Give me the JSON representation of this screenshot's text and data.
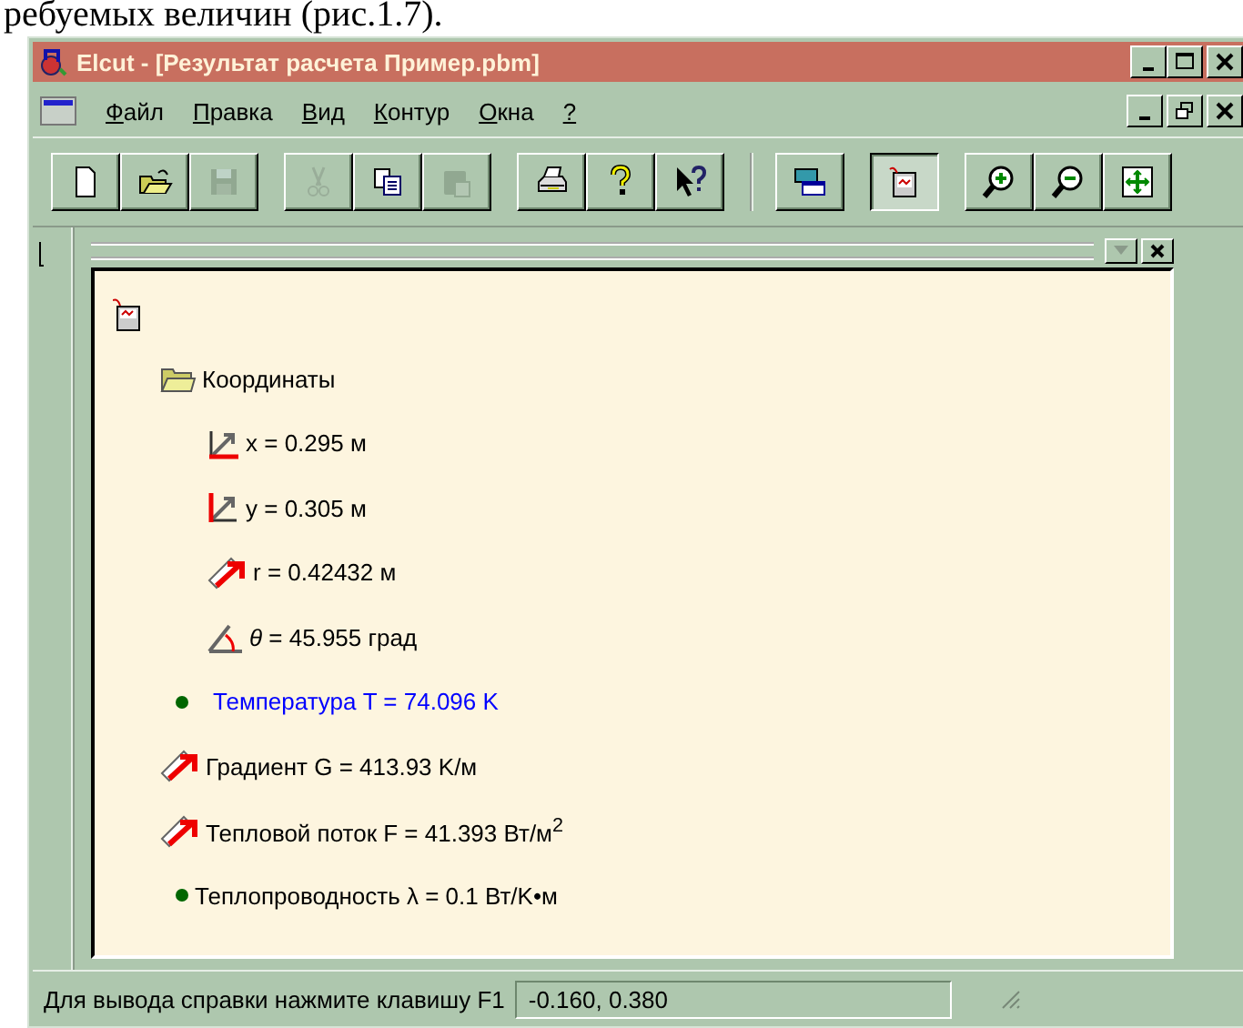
{
  "document_text": "ребуемых величин (рис.1.7).",
  "window": {
    "title": "Elcut - [Результат расчета Пример.pbm]"
  },
  "menu": [
    {
      "label": "Файл"
    },
    {
      "label": "Правка"
    },
    {
      "label": "Вид"
    },
    {
      "label": "Контур"
    },
    {
      "label": "Окна"
    },
    {
      "label": "?"
    }
  ],
  "toolbar": [
    [
      {
        "kind": "new",
        "disabled": false,
        "pressed": false
      },
      {
        "kind": "open",
        "disabled": false,
        "pressed": false
      },
      {
        "kind": "save",
        "disabled": true,
        "pressed": false
      }
    ],
    [
      {
        "kind": "cut",
        "disabled": true,
        "pressed": false
      },
      {
        "kind": "copy",
        "disabled": false,
        "pressed": false
      },
      {
        "kind": "paste",
        "disabled": true,
        "pressed": false
      }
    ],
    [
      {
        "kind": "print",
        "disabled": false,
        "pressed": false
      },
      {
        "kind": "help",
        "disabled": false,
        "pressed": false
      },
      {
        "kind": "context-help",
        "disabled": false,
        "pressed": false
      }
    ],
    [
      {
        "kind": "windows",
        "disabled": false,
        "pressed": false
      }
    ],
    [
      {
        "kind": "results",
        "disabled": false,
        "pressed": true
      }
    ],
    [
      {
        "kind": "zoom-in",
        "disabled": false,
        "pressed": false
      },
      {
        "kind": "zoom-out",
        "disabled": false,
        "pressed": false
      },
      {
        "kind": "fit",
        "disabled": false,
        "pressed": false
      }
    ]
  ],
  "tree": [
    {
      "kind": "results",
      "children": [
        {
          "kind": "folder",
          "label": "Координаты",
          "highlighted": false,
          "children": [
            {
              "kind": "coord-x",
              "label": "x = 0.295 м",
              "highlighted": false
            },
            {
              "kind": "coord-y",
              "label": "y = 0.305 м",
              "highlighted": false
            },
            {
              "kind": "vector",
              "label": "r = 0.42432 м",
              "highlighted": false
            },
            {
              "kind": "angle",
              "label": "*θ* = 45.955 град",
              "highlighted": false
            }
          ]
        },
        {
          "kind": "scalar",
          "label": "Температура T = 74.096 K",
          "highlighted": true
        },
        {
          "kind": "vector",
          "label": "Градиент G = 413.93 K/м",
          "highlighted": false
        },
        {
          "kind": "vector",
          "label": "Тепловой поток F = 41.393 Вт/м$^{2}$",
          "highlighted": false
        },
        {
          "kind": "scalar",
          "label": "Теплопроводность λ = 0.1 Вт/K•м",
          "highlighted": false
        }
      ]
    }
  ],
  "status_bar": {
    "message": "Для вывода справки нажмите клавишу F1",
    "coordinates": "-0.160, 0.380"
  }
}
